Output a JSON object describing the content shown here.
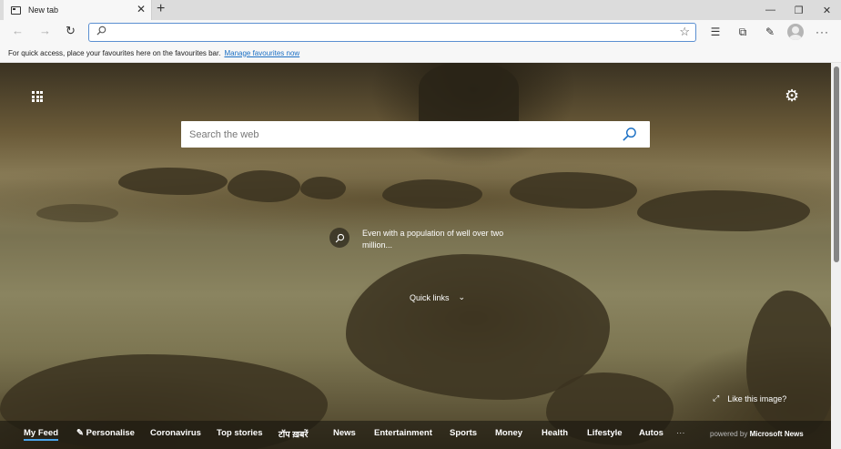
{
  "tab": {
    "title": "New tab",
    "close_glyph": "✕",
    "icon": "newtab-page-icon"
  },
  "new_tab_glyph": "+",
  "window_controls": {
    "minimize": "—",
    "restore": "❐",
    "close": "✕"
  },
  "toolbar": {
    "back": "←",
    "forward": "→",
    "refresh": "↻",
    "address_value": "",
    "favorite_star": "☆",
    "icons": [
      {
        "name": "favorites-list-icon",
        "glyph": "☰"
      },
      {
        "name": "collections-icon",
        "glyph": "⧉"
      },
      {
        "name": "feedback-icon",
        "glyph": "✎"
      }
    ],
    "more": "···"
  },
  "favbar": {
    "text": "For quick access, place your favourites here on the favourites bar.",
    "link": "Manage favourites now"
  },
  "newtab": {
    "settings_glyph": "⚙",
    "search_placeholder": "Search the web",
    "info_text": "Even with a population of well over two million...",
    "quick_links": "Quick links",
    "quick_links_chevron": "⌄",
    "like_image": "Like this image?",
    "expand_glyph": "⤢",
    "feed_tabs": [
      {
        "label": "My Feed"
      },
      {
        "label": "Personalise",
        "prefix": "✎"
      },
      {
        "label": "Coronavirus"
      },
      {
        "label": "Top stories"
      },
      {
        "label": "टॉप ख़बरें"
      },
      {
        "label": "News"
      },
      {
        "label": "Entertainment"
      },
      {
        "label": "Sports"
      },
      {
        "label": "Money"
      },
      {
        "label": "Health"
      },
      {
        "label": "Lifestyle"
      },
      {
        "label": "Autos"
      },
      {
        "label": "···"
      }
    ],
    "powered_by": "powered by",
    "powered_brand": "Microsoft News"
  }
}
